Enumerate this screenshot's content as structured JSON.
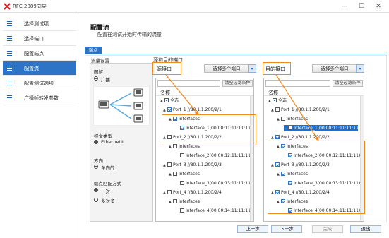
{
  "window": {
    "title": "RFC 2889向导",
    "controls": {
      "minimize": "—",
      "maximize": "☐",
      "close": "✕"
    }
  },
  "sidebar": {
    "items": [
      {
        "label": "选择测试项",
        "active": false
      },
      {
        "label": "选择端口",
        "active": false
      },
      {
        "label": "配置端点",
        "active": false
      },
      {
        "label": "配置流",
        "active": true
      },
      {
        "label": "配置测试选项",
        "active": false
      },
      {
        "label": "广播帧转发参数",
        "active": false
      }
    ]
  },
  "header": {
    "title": "配置流",
    "subtitle": "配置在测试开始时传输的流量"
  },
  "tabs": [
    {
      "label": "端点"
    }
  ],
  "flow": {
    "group_label": "流量设置",
    "topology": {
      "title": "图解",
      "option": "广播"
    },
    "packet_type": {
      "title": "报文类型",
      "option": "EthernetII"
    },
    "direction": {
      "title": "方向",
      "option": "单向的"
    },
    "endpoint_mode": {
      "title": "端点匹配方式",
      "options": [
        "一对一",
        "多对多"
      ]
    }
  },
  "ports_section": {
    "label": "源和目的端口"
  },
  "source": {
    "label": "源接口",
    "multi_button": "选择多个端口",
    "filter_button": "清空过滤条件",
    "column_header": "名称",
    "nodes": [
      {
        "text": "全选",
        "level": 0,
        "check": "part",
        "toggle": "▲"
      },
      {
        "text": "Port_1 //80.1.1.200/2/1",
        "level": 1,
        "check": "on",
        "toggle": "▲"
      },
      {
        "text": "Interfaces",
        "level": 2,
        "check": "on",
        "toggle": "▲"
      },
      {
        "text": "Interface_1(00:00:11:11:11:11)",
        "level": 3,
        "check": "on",
        "toggle": ""
      },
      {
        "text": "Port_2 //80.1.1.200/2/2",
        "level": 1,
        "check": "off",
        "toggle": "▲"
      },
      {
        "text": "Interfaces",
        "level": 2,
        "check": "off",
        "toggle": "▲"
      },
      {
        "text": "Interface_2(00:00:12:11:11:11)",
        "level": 3,
        "check": "off",
        "toggle": ""
      },
      {
        "text": "Port_3 //80.1.1.200/2/3",
        "level": 1,
        "check": "off",
        "toggle": "▲"
      },
      {
        "text": "Interfaces",
        "level": 2,
        "check": "off",
        "toggle": "▲"
      },
      {
        "text": "Interface_3(00:00:13:11:11:11)",
        "level": 3,
        "check": "off",
        "toggle": ""
      },
      {
        "text": "Port_4 //80.1.1.200/2/4",
        "level": 1,
        "check": "off",
        "toggle": "▲"
      },
      {
        "text": "Interfaces",
        "level": 2,
        "check": "off",
        "toggle": "▲"
      },
      {
        "text": "Interface_4(00:00:14:11:11:11)",
        "level": 3,
        "check": "off",
        "toggle": ""
      }
    ]
  },
  "destination": {
    "label": "目的接口",
    "multi_button": "选择多个端口",
    "filter_button": "清空过滤条件",
    "column_header": "名称",
    "nodes": [
      {
        "text": "全选",
        "level": 0,
        "check": "part",
        "toggle": "▲"
      },
      {
        "text": "Port_1 //80.1.1.200/2/1",
        "level": 1,
        "check": "off",
        "toggle": "▲"
      },
      {
        "text": "Interfaces",
        "level": 2,
        "check": "off",
        "toggle": "▲"
      },
      {
        "text": "Interface_1(00:00:11:11:11:11)",
        "level": 3,
        "check": "off",
        "toggle": "",
        "selected": true
      },
      {
        "text": "Port_2 //80.1.1.200/2/2",
        "level": 1,
        "check": "on",
        "toggle": "▲"
      },
      {
        "text": "Interfaces",
        "level": 2,
        "check": "on",
        "toggle": "▲"
      },
      {
        "text": "Interface_2(00:00:12:11:11:11)",
        "level": 3,
        "check": "on",
        "toggle": ""
      },
      {
        "text": "Port_3 //80.1.1.200/2/3",
        "level": 1,
        "check": "on",
        "toggle": "▲"
      },
      {
        "text": "Interfaces",
        "level": 2,
        "check": "on",
        "toggle": "▲"
      },
      {
        "text": "Interface_3(00:00:13:11:11:11)",
        "level": 3,
        "check": "on",
        "toggle": ""
      },
      {
        "text": "Port_4 //80.1.1.200/2/4",
        "level": 1,
        "check": "on",
        "toggle": "▲"
      },
      {
        "text": "Interfaces",
        "level": 2,
        "check": "on",
        "toggle": "▲"
      },
      {
        "text": "Interface_4(00:00:14:11:11:11)",
        "level": 3,
        "check": "on",
        "toggle": ""
      }
    ]
  },
  "footer": {
    "prev": "上一步",
    "next": "下一步",
    "finish": "完成",
    "exit": "退出"
  },
  "colors": {
    "accent": "#2e74c6",
    "highlight": "#f08a1f"
  }
}
